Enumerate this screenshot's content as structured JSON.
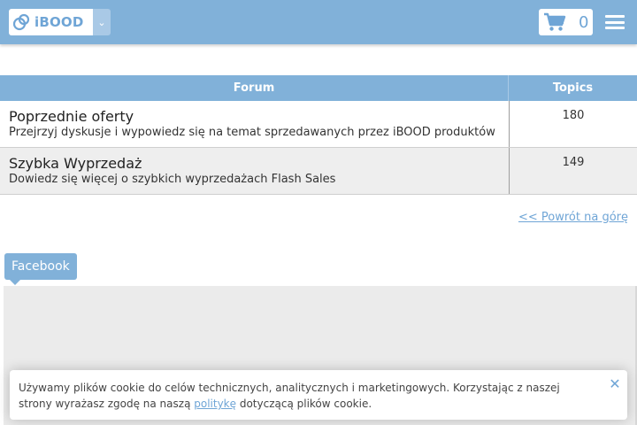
{
  "header": {
    "logo_text": "iBOOD",
    "cart_count": "0",
    "colors": {
      "bar": "#81b1d9",
      "accent": "#6fa5d6"
    }
  },
  "table": {
    "col_forum": "Forum",
    "col_topics": "Topics",
    "rows": [
      {
        "title": "Poprzednie oferty",
        "desc": "Przejrzyj dyskusje i wypowiedz się na temat sprzedawanych przez iBOOD produktów",
        "topics": "180"
      },
      {
        "title": "Szybka Wyprzedaż",
        "desc": "Dowiedz się więcej o szybkich wyprzedażach Flash Sales",
        "topics": "149"
      }
    ]
  },
  "back_to_top": "<< Powrót na górę",
  "facebook": {
    "tab_label": "Facebook"
  },
  "cookie": {
    "text_before": "Używamy plików cookie do celów technicznych, analitycznych i marketingowych. Korzystając z naszej strony wyrażasz zgodę na naszą",
    "link": "politykę",
    "text_after": "dotyczącą plików cookie.",
    "close_icon": "close-icon"
  }
}
